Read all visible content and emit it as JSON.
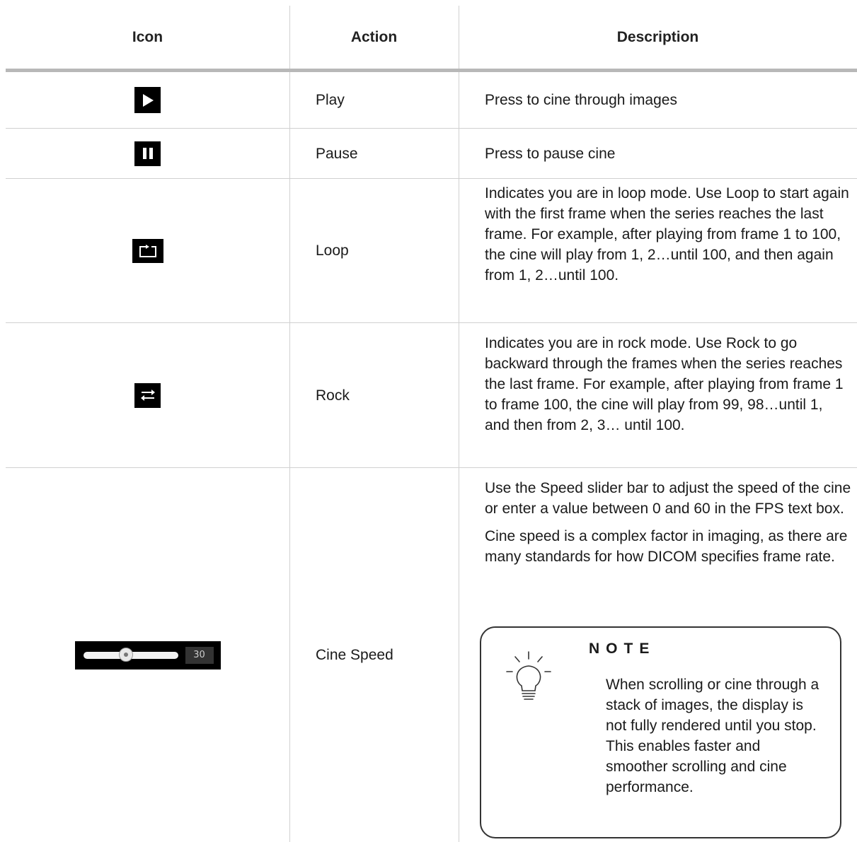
{
  "table": {
    "headers": [
      "Icon",
      "Action",
      "Description"
    ],
    "rows": [
      {
        "icon": "play-icon",
        "action": "Play",
        "description": [
          "Press to cine through images"
        ]
      },
      {
        "icon": "pause-icon",
        "action": "Pause",
        "description": [
          "Press to pause cine"
        ]
      },
      {
        "icon": "loop-icon",
        "action": "Loop",
        "description": [
          "Indicates you are in loop mode. Use Loop to start again with the first frame when the series reaches the last frame. For example, after playing from frame 1 to 100, the cine will play from 1, 2…until 100, and then again from 1, 2…until 100."
        ]
      },
      {
        "icon": "rock-icon",
        "action": "Rock",
        "description": [
          "Indicates you are in rock mode. Use Rock to go backward through the frames when the series reaches the last frame. For example, after playing from frame 1 to frame 100, the cine will play from 99, 98…until 1, and then from 2, 3… until 100."
        ]
      },
      {
        "icon": "speed-slider-icon",
        "action": "Cine Speed",
        "description": [
          "Use the Speed slider bar to adjust the speed of the cine or enter a value between 0 and 60 in the FPS text box.",
          "Cine speed is a complex factor in imaging, as there are many standards for how DICOM specifies frame rate."
        ],
        "slider": {
          "value": "30",
          "fraction": 0.45
        }
      }
    ],
    "note": {
      "icon": "lightbulb-icon",
      "title": "NOTE",
      "text": "When scrolling or cine through a stack of images, the display is not fully rendered until you stop. This enables faster and smoother scrolling and cine performance."
    }
  }
}
